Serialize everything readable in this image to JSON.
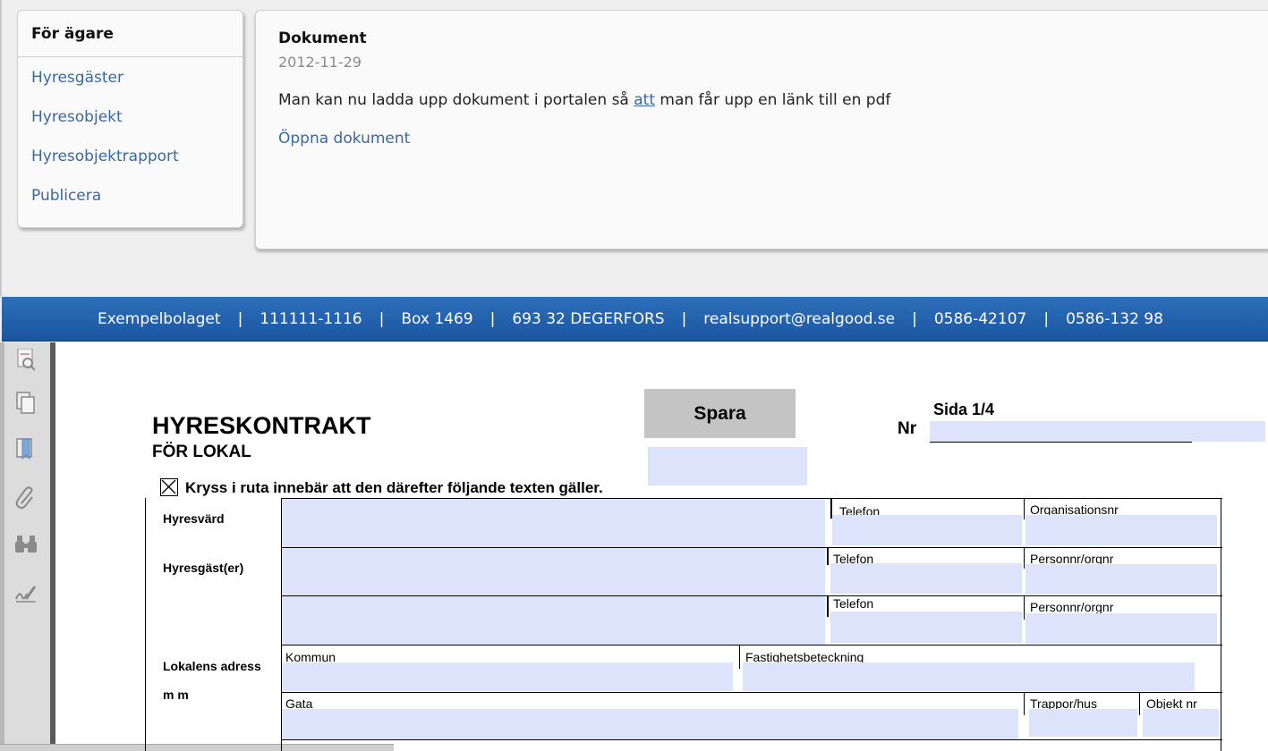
{
  "sidebar": {
    "title": "För ägare",
    "items": [
      "Hyresgäster",
      "Hyresobjekt",
      "Hyresobjektrapport",
      "Publicera"
    ]
  },
  "news": {
    "heading": "Dokument",
    "date": "2012-11-29",
    "body_before": "Man kan nu ladda upp dokument i portalen så ",
    "body_link": "att",
    "body_after": " man får upp en länk till en pdf",
    "open_link": "Öppna dokument"
  },
  "footer": {
    "items": [
      "Exempelbolaget",
      "111111-1116",
      "Box 1469",
      "693 32 DEGERFORS",
      "realsupport@realgood.se",
      "0586-42107",
      "0586-132 98"
    ],
    "separator": "|"
  },
  "toolbar_icons": [
    "signature-pen-icon",
    "pages-icon",
    "bookmark-icon",
    "attachment-icon",
    "search-binoculars-icon",
    "sign-icon"
  ],
  "form": {
    "title": "HYRESKONTRAKT",
    "subtitle": "FÖR LOKAL",
    "save_button": "Spara",
    "page_label": "Sida 1/4",
    "nr_label": "Nr",
    "checkbox_note": "Kryss i ruta innebär att den därefter följande texten gäller.",
    "rows": {
      "landlord": "Hyresvärd",
      "tenant": "Hyresgäst(er)",
      "address_line1": "Lokalens adress",
      "address_line2": "m m"
    },
    "fields": {
      "phone": "Telefon",
      "org_nr": "Organisationsnr",
      "person_nr": "Personnr/orgnr",
      "municipality": "Kommun",
      "property": "Fastighetsbeteckning",
      "street": "Gata",
      "stairs": "Trappor/hus",
      "object_nr": "Objekt nr"
    }
  },
  "colors": {
    "link": "#3a68a0",
    "footer_blue": "#2462ad",
    "field_fill": "#dce3fb"
  }
}
